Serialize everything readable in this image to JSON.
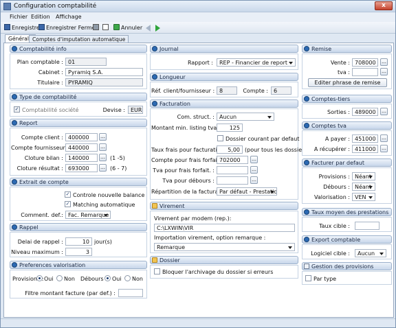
{
  "window": {
    "title": "Configuration comptabilité",
    "close": "x"
  },
  "menu": {
    "fichier": "Fichier",
    "edition": "Edition",
    "affichage": "Affichage"
  },
  "toolbar": {
    "save": "Enregistrer",
    "save_close": "Enregistrer Fermer",
    "cancel": "Annuler"
  },
  "tabs": {
    "general": "Générale",
    "imputation": "Comptes d'imputation automatique"
  },
  "info": {
    "title": "Comptabilité info",
    "plan_label": "Plan comptable :",
    "plan_value": "01",
    "cabinet_label": "Cabinet :",
    "cabinet_value": "Pyramiq S.A.",
    "titulaire_label": "Titulaire :",
    "titulaire_value": "PYRAMIQ"
  },
  "type": {
    "title": "Type de comptabilité",
    "societe_label": "Comptabilité société",
    "devise_label": "Devise :",
    "devise_value": "EUR"
  },
  "report": {
    "title": "Report",
    "client_label": "Compte client :",
    "client_value": "400000",
    "fournisseur_label": "Compte fournisseur :",
    "fournisseur_value": "440000",
    "bilan_label": "Cloture bilan :",
    "bilan_value": "140000",
    "bilan_range": "(1 -5)",
    "resultat_label": "Cloture résultat :",
    "resultat_value": "693000",
    "resultat_range": "(6 - 7)"
  },
  "extrait": {
    "title": "Extrait de compte",
    "balance_label": "Controle nouvelle balance",
    "matching_label": "Matching automatique",
    "comment_label": "Comment. def.:",
    "comment_value": "Fac. Remarque"
  },
  "rappel": {
    "title": "Rappel",
    "delai_label": "Delai de rappel :",
    "delai_value": "10",
    "delai_unit": "jour(s)",
    "niveau_label": "Niveau maximum :",
    "niveau_value": "3"
  },
  "pref": {
    "title": "Preferences valorisation",
    "provisions_label": "Provisions :",
    "oui": "Oui",
    "non": "Non",
    "debours_label": "Débours :",
    "filtre_label": "Filtre montant facture (par def.) :",
    "filtre_value": ""
  },
  "journal": {
    "title": "Journal",
    "rapport_label": "Rapport :",
    "rapport_value": "REP - Financier de report"
  },
  "longueur": {
    "title": "Longueur",
    "ref_label": "Réf. client/fournisseur :",
    "ref_value": "8",
    "compte_label": "Compte :",
    "compte_value": "6"
  },
  "facturation": {
    "title": "Facturation",
    "comstruct_label": "Com. struct. :",
    "comstruct_value": "Aucun",
    "montant_label": "Montant min. listing tva :",
    "montant_value": "125",
    "dossier_label": "Dossier courant par defaut",
    "taux_label": "Taux frais pour facturation :",
    "taux_value": "5,00",
    "taux_note": "(pour tous les dossiers)",
    "compte_frais_label": "Compte pour frais forfait. :",
    "compte_frais_value": "702000",
    "tva_frais_label": "Tva pour frais forfait. :",
    "tva_frais_value": "",
    "tva_debours_label": "Tva pour débours :",
    "tva_debours_value": "",
    "repartition_label": "Répartition de la facturation :",
    "repartition_value": "Par défaut - Prestations"
  },
  "virement": {
    "title": "Virement",
    "modem_label": "Virement par modem (rep.):",
    "modem_value": "C:\\LXWIN\\VIR",
    "import_label": "Importation virement, option remarque :",
    "import_value": "Remarque"
  },
  "dossier": {
    "title": "Dossier",
    "bloquer_label": "Bloquer l'archivage du dossier si erreurs"
  },
  "remise": {
    "title": "Remise",
    "vente_label": "Vente :",
    "vente_value": "708000",
    "tva_label": "tva :",
    "tva_value": "",
    "edit_button": "Editer phrase de remise"
  },
  "comptes_tiers": {
    "title": "Comptes-tiers",
    "sorties_label": "Sorties :",
    "sorties_value": "489000"
  },
  "comptes_tva": {
    "title": "Comptes tva",
    "payer_label": "A payer :",
    "payer_value": "451000",
    "recuperer_label": "A récupérer :",
    "recuperer_value": "411000"
  },
  "facturer": {
    "title": "Facturer par defaut",
    "provisions_label": "Provisions :",
    "provisions_value": "Néant",
    "debours_label": "Débours :",
    "debours_value": "Néant",
    "valorisation_label": "Valorisation :",
    "valorisation_value": "VEN"
  },
  "taux_moyen": {
    "title": "Taux moyen des prestations",
    "cible_label": "Taux cible :",
    "cible_value": ""
  },
  "export": {
    "title": "Export comptable",
    "logiciel_label": "Logiciel cible :",
    "logiciel_value": "Aucun"
  },
  "gestion": {
    "title": "Gestion des provisions",
    "partype_label": "Par type"
  }
}
